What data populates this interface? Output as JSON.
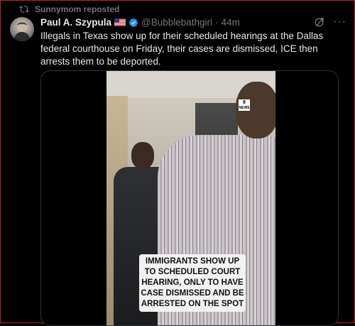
{
  "repost": {
    "label": "Sunnymom reposted",
    "icon": "repost-icon"
  },
  "post": {
    "display_name": "Paul A. Szypula",
    "flag_icon": "us-flag-icon",
    "verified_icon": "verified-badge-icon",
    "handle": "@Bubblebathgirl",
    "separator": "·",
    "time": "44m",
    "text": "Illegals in Texas show up for their scheduled hearings at the Dallas federal courthouse on Friday, their cases are dismissed, ICE then arrests them to be deported.",
    "grok_icon": "grok-icon",
    "more_icon": "more-icon",
    "more_glyph": "···"
  },
  "media": {
    "news_logo_top": "8",
    "news_logo_bottom": "NEWS",
    "caption": "IMMIGRANTS SHOW UP TO SCHEDULED COURT HEARING, ONLY TO HAVE CASE DISMISSED AND BE ARRESTED ON THE SPOT"
  },
  "colors": {
    "background": "#000000",
    "primary_text": "#e7e9ea",
    "secondary_text": "#71767b",
    "verified": "#1d9bf0",
    "frame_border": "#d21b1b"
  }
}
